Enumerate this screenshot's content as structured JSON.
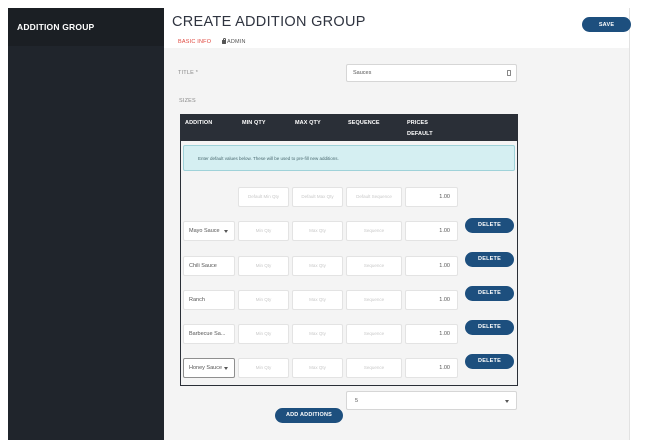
{
  "sidebar": {
    "title": "ADDITION GROUP"
  },
  "header": {
    "title": "CREATE ADDITION GROUP",
    "save_label": "SAVE"
  },
  "tabs": [
    {
      "label": "BASIC INFO",
      "active": true
    },
    {
      "label": "ADMIN",
      "icon": "lock-icon"
    }
  ],
  "form": {
    "title_label": "TITLE *",
    "title_value": "Sauces",
    "sizes_label": "SIZES"
  },
  "table": {
    "headers": {
      "addition": "ADDITION",
      "min_qty": "MIN QTY",
      "max_qty": "MAX QTY",
      "sequence": "SEQUENCE",
      "prices": "PRICES",
      "default": "DEFAULT"
    },
    "info": "Enter default values below. These will be used to pre-fill new additions.",
    "defaults_row": {
      "min_placeholder": "Default Min Qty",
      "max_placeholder": "Default Max Qty",
      "seq_placeholder": "Default Sequence",
      "price": "1.00"
    },
    "rows": [
      {
        "name": "Mayo Sauce",
        "dropdown": true,
        "min": "Min Qty",
        "max": "Max Qty",
        "seq": "Sequence",
        "price": "1.00",
        "delete": "DELETE"
      },
      {
        "name": "Chili Sauce",
        "dropdown": false,
        "min": "Min Qty",
        "max": "Max Qty",
        "seq": "Sequence",
        "price": "1.00",
        "delete": "DELETE"
      },
      {
        "name": "Ranch",
        "dropdown": false,
        "min": "Min Qty",
        "max": "Max Qty",
        "seq": "Sequence",
        "price": "1.00",
        "delete": "DELETE"
      },
      {
        "name": "Barbecue Sa...",
        "dropdown": false,
        "min": "Min Qty",
        "max": "Max Qty",
        "seq": "Sequence",
        "price": "1.00",
        "delete": "DELETE"
      },
      {
        "name": "Honey Sauce",
        "dropdown": true,
        "min": "Min Qty",
        "max": "Max Qty",
        "seq": "Sequence",
        "price": "1.00",
        "delete": "DELETE"
      }
    ]
  },
  "footer": {
    "select_value": "5",
    "add_label": "ADD ADDITIONS"
  }
}
